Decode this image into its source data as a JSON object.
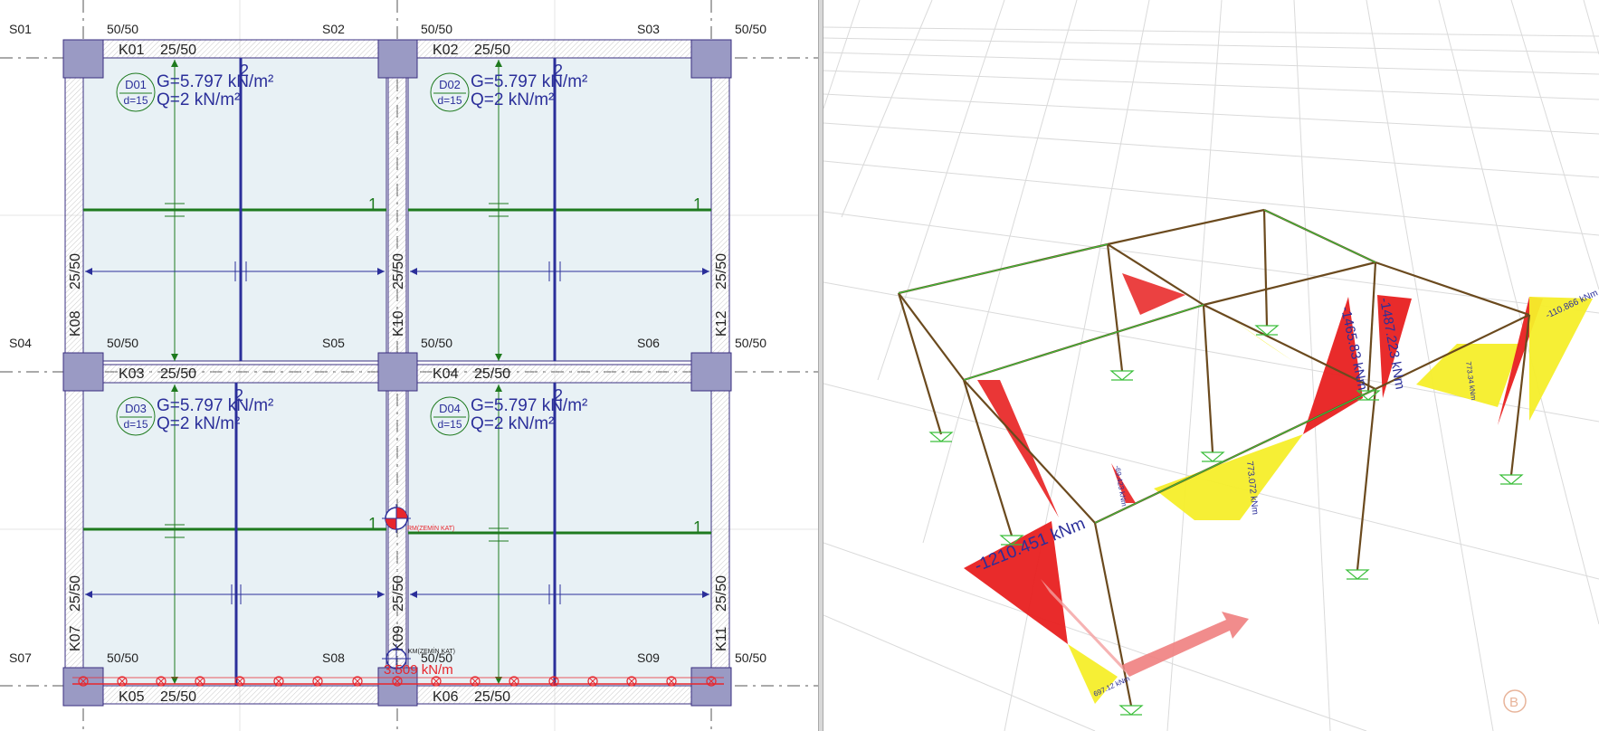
{
  "plan": {
    "columns": [
      {
        "id": "S01",
        "section": "50/50"
      },
      {
        "id": "S02",
        "section": "50/50"
      },
      {
        "id": "S03",
        "section": "50/50"
      },
      {
        "id": "S04",
        "section": "50/50"
      },
      {
        "id": "S05",
        "section": "50/50"
      },
      {
        "id": "S06",
        "section": "50/50"
      },
      {
        "id": "S07",
        "section": "50/50"
      },
      {
        "id": "S08",
        "section": "50/50"
      },
      {
        "id": "S09",
        "section": "50/50"
      }
    ],
    "beams_h": [
      {
        "id": "K01",
        "section": "25/50"
      },
      {
        "id": "K02",
        "section": "25/50"
      },
      {
        "id": "K03",
        "section": "25/50"
      },
      {
        "id": "K04",
        "section": "25/50"
      },
      {
        "id": "K05",
        "section": "25/50"
      },
      {
        "id": "K06",
        "section": "25/50"
      }
    ],
    "beams_v": [
      {
        "id": "K08",
        "section": "25/50"
      },
      {
        "id": "K10",
        "section": "25/50"
      },
      {
        "id": "K12",
        "section": "25/50"
      },
      {
        "id": "K07",
        "section": "25/50"
      },
      {
        "id": "K09",
        "section": "25/50"
      },
      {
        "id": "K11",
        "section": "25/50"
      }
    ],
    "slabs": [
      {
        "id": "D01",
        "thickness": "d=15",
        "G": "G=5.797 kN/m²",
        "Q": "Q=2 kN/m²"
      },
      {
        "id": "D02",
        "thickness": "d=15",
        "G": "G=5.797 kN/m²",
        "Q": "Q=2 kN/m²"
      },
      {
        "id": "D03",
        "thickness": "d=15",
        "G": "G=5.797 kN/m²",
        "Q": "Q=2 kN/m²"
      },
      {
        "id": "D04",
        "thickness": "d=15",
        "G": "G=5.797 kN/m²",
        "Q": "Q=2 kN/m²"
      }
    ],
    "axis_label_1": "1",
    "axis_label_2": "2",
    "mass_center_label": "KM(ZEMİN KAT)",
    "rigidity_center_label": "RM(ZEMİN KAT)",
    "line_load_label": "3.509 kN/m",
    "colors": {
      "slab_fill": "#e8f1f5",
      "beam_fill": "#eeeeee",
      "column_fill": "#9a9ac4",
      "outline": "#3a2f80",
      "green": "#1e7a1e",
      "blue": "#2b2f9a",
      "red": "#e8262c"
    }
  },
  "view3d": {
    "moment_labels": [
      "-1210.451 kNm",
      "-1465.83 kNm",
      "-1487.223 kNm",
      "773.072 kNm",
      "-110.866 kNm",
      "773.34 kNm",
      "-69.423 kNm",
      "697.12 kNm"
    ],
    "axis_marker": "B",
    "colors": {
      "moment_negative": "#e82020",
      "moment_positive": "#f5ee2a",
      "frame": "#6b4a1e",
      "frame_green": "#3cbf3c",
      "grid": "#d6d6d6"
    }
  }
}
